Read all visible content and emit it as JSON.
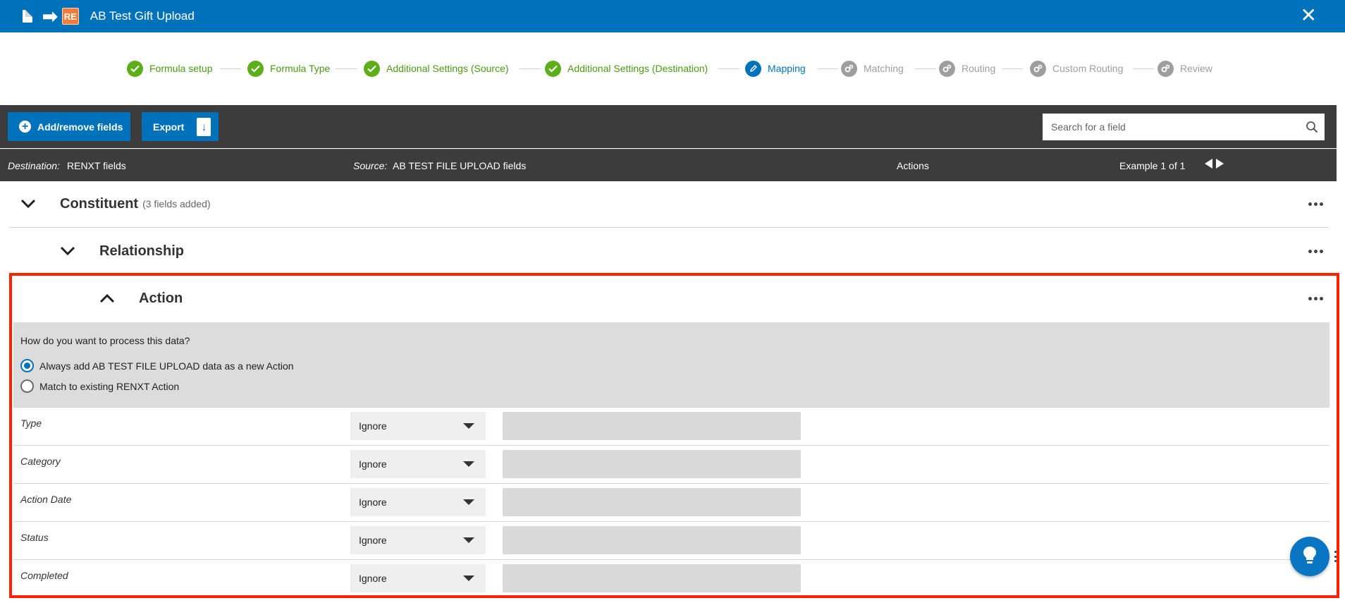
{
  "window": {
    "title": "AB Test Gift Upload",
    "re_badge": "RE",
    "close_label": "✕"
  },
  "stepper": [
    {
      "label": "Formula setup",
      "state": "done"
    },
    {
      "label": "Formula Type",
      "state": "done"
    },
    {
      "label": "Additional Settings (Source)",
      "state": "done"
    },
    {
      "label": "Additional Settings (Destination)",
      "state": "done"
    },
    {
      "label": "Mapping",
      "state": "active"
    },
    {
      "label": "Matching",
      "state": "todo"
    },
    {
      "label": "Routing",
      "state": "todo"
    },
    {
      "label": "Custom Routing",
      "state": "todo"
    },
    {
      "label": "Review",
      "state": "todo"
    }
  ],
  "toolbar": {
    "add_label": "Add/remove fields",
    "export_label": "Export",
    "search_placeholder": "Search for a field"
  },
  "columns": {
    "destination_label": "Destination:",
    "destination_value": "RENXT fields",
    "source_label": "Source:",
    "source_value": "AB TEST FILE UPLOAD fields",
    "actions": "Actions",
    "example": "Example 1 of 1"
  },
  "sections": {
    "constituent": {
      "title": "Constituent",
      "subtitle": "(3 fields added)"
    },
    "relationship": {
      "title": "Relationship"
    },
    "action": {
      "title": "Action"
    }
  },
  "process": {
    "question": "How do you want to process this data?",
    "options": [
      {
        "label": "Always add AB TEST FILE UPLOAD data as a new Action",
        "selected": true
      },
      {
        "label": "Match to existing RENXT Action",
        "selected": false
      }
    ]
  },
  "fields": [
    {
      "label": "Type",
      "mapping": "Ignore"
    },
    {
      "label": "Category",
      "mapping": "Ignore"
    },
    {
      "label": "Action Date",
      "mapping": "Ignore"
    },
    {
      "label": "Status",
      "mapping": "Ignore"
    },
    {
      "label": "Completed",
      "mapping": "Ignore"
    }
  ],
  "colors": {
    "brand_blue": "#0072bc",
    "done_green": "#5cae1b",
    "highlight_red": "#ff2000",
    "toolbar_dark": "#3c3c3c"
  }
}
